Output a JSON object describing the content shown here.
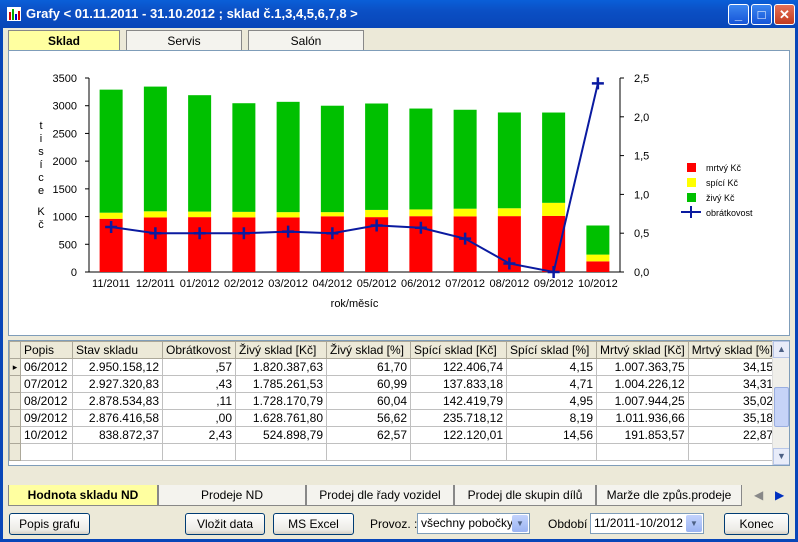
{
  "window": {
    "title": "Grafy < 01.11.2011 - 31.10.2012 ; sklad č.1,3,4,5,6,7,8 >",
    "min_symbol": "_",
    "max_symbol": "□",
    "close_symbol": "✕"
  },
  "top_tabs": [
    "Sklad",
    "Servis",
    "Salón"
  ],
  "chart_data": {
    "type": "bar",
    "stacked": true,
    "categories": [
      "11/2011",
      "12/2011",
      "01/2012",
      "02/2012",
      "03/2012",
      "04/2012",
      "05/2012",
      "06/2012",
      "07/2012",
      "08/2012",
      "09/2012",
      "10/2012"
    ],
    "series": [
      {
        "name": "mrtvý Kč",
        "color": "#ff0000",
        "values": [
          960,
          985,
          990,
          985,
          985,
          1005,
          990,
          1007,
          1004,
          1008,
          1012,
          192
        ]
      },
      {
        "name": "spící Kč",
        "color": "#ffff00",
        "values": [
          110,
          110,
          100,
          100,
          95,
          75,
          130,
          122,
          138,
          142,
          236,
          122
        ]
      },
      {
        "name": "živý Kč",
        "color": "#00c000",
        "values": [
          2220,
          2250,
          2100,
          1960,
          1990,
          1920,
          1920,
          1820,
          1785,
          1728,
          1629,
          525
        ]
      }
    ],
    "line_series": {
      "name": "obrátkovost",
      "color": "#0a1aa0",
      "axis": "right",
      "values": [
        0.58,
        0.5,
        0.5,
        0.5,
        0.52,
        0.5,
        0.6,
        0.57,
        0.43,
        0.11,
        0.0,
        2.43
      ]
    },
    "y_left": {
      "ticks": [
        "0",
        "500",
        "1000",
        "1500",
        "2000",
        "2500",
        "3000",
        "3500"
      ],
      "ylim": [
        0,
        3500
      ],
      "label": "tisíce Kč"
    },
    "y_right": {
      "ticks": [
        "0,0",
        "0,5",
        "1,0",
        "1,5",
        "2,0",
        "2,5"
      ],
      "ylim": [
        0,
        2.5
      ]
    },
    "xlabel": "rok/měsíc",
    "legend_position": "right"
  },
  "table": {
    "columns": [
      "Popis",
      "Stav skladu",
      "Obrátkovost",
      "Živý sklad [Kč]",
      "Živý sklad [%]",
      "Spící sklad [Kč]",
      "Spící sklad [%]",
      "Mrtvý sklad [Kč]",
      "Mrtvý sklad [%]"
    ],
    "rows": [
      [
        "06/2012",
        "2.950.158,12",
        ",57",
        "1.820.387,63",
        "61,70",
        "122.406,74",
        "4,15",
        "1.007.363,75",
        "34,15"
      ],
      [
        "07/2012",
        "2.927.320,83",
        ",43",
        "1.785.261,53",
        "60,99",
        "137.833,18",
        "4,71",
        "1.004.226,12",
        "34,31"
      ],
      [
        "08/2012",
        "2.878.534,83",
        ",11",
        "1.728.170,79",
        "60,04",
        "142.419,79",
        "4,95",
        "1.007.944,25",
        "35,02"
      ],
      [
        "09/2012",
        "2.876.416,58",
        ",00",
        "1.628.761,80",
        "56,62",
        "235.718,12",
        "8,19",
        "1.011.936,66",
        "35,18"
      ],
      [
        "10/2012",
        "838.872,37",
        "2,43",
        "524.898,79",
        "62,57",
        "122.120,01",
        "14,56",
        "191.853,57",
        "22,87"
      ]
    ],
    "current_row_marker": "▸"
  },
  "bottom_tabs": [
    "Hodnota skladu ND",
    "Prodeje ND",
    "Prodej dle řady vozidel",
    "Prodej dle skupin dílů",
    "Marže dle způs.prodeje"
  ],
  "buttons": {
    "popis_grafu": "Popis grafu",
    "vlozit_data": "Vložit data",
    "ms_excel": "MS Excel",
    "konec": "Konec"
  },
  "filters": {
    "provoz_label": "Provoz. :",
    "provoz_value": "všechny pobočky",
    "obdobi_label": "Období :",
    "obdobi_value": "11/2011-10/2012"
  },
  "icons": {
    "dropdown": "▼",
    "scroll_up": "▲",
    "scroll_down": "▼",
    "nav_left": "◀",
    "nav_right": "▶"
  }
}
